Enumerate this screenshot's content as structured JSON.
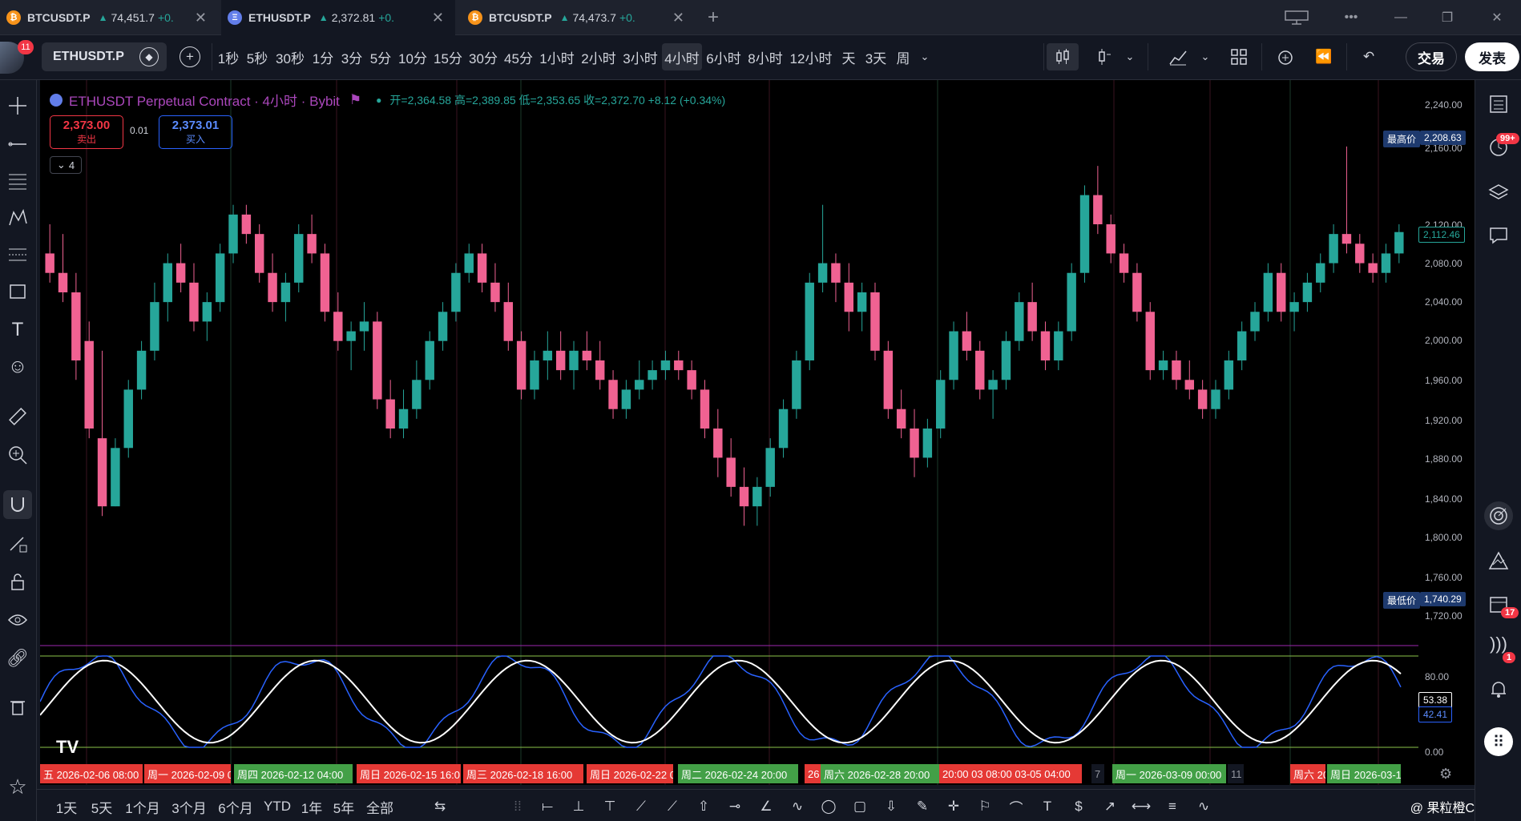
{
  "tabs": [
    {
      "coin": "₿",
      "coin_color": "#f7931a",
      "symbol": "BTCUSDT.P",
      "price": "74,451.7",
      "change": "+0.",
      "active": false
    },
    {
      "coin": "Ξ",
      "coin_color": "#627eea",
      "symbol": "ETHUSDT.P",
      "price": "2,372.81",
      "change": "+0.",
      "active": true
    },
    {
      "coin": "₿",
      "coin_color": "#f7931a",
      "symbol": "BTCUSDT.P",
      "price": "74,473.7",
      "change": "+0.",
      "active": false
    }
  ],
  "toolbar": {
    "avatar_badge": "11",
    "symbol": "ETHUSDT.P",
    "intervals": [
      "1秒",
      "5秒",
      "30秒",
      "1分",
      "3分",
      "5分",
      "10分",
      "15分",
      "30分",
      "45分",
      "1小时",
      "2小时",
      "3小时",
      "4小时",
      "6小时",
      "8小时",
      "12小时",
      "天",
      "3天",
      "周"
    ],
    "active_interval": "4小时",
    "trade_label": "交易",
    "publish_label": "发表"
  },
  "legend": {
    "title": "ETHUSDT Perpetual Contract · 4小时 · Bybit",
    "ohlc": "开=2,364.58 高=2,389.85 低=2,353.65 收=2,372.70 +8.12 (+0.34%)"
  },
  "quote": {
    "sell_price": "2,373.00",
    "sell_label": "卖出",
    "spread": "0.01",
    "buy_price": "2,373.01",
    "buy_label": "买入",
    "collapse_count": "4"
  },
  "price_axis": {
    "labels": [
      "2,240.00",
      "2,160.00",
      "2,120.00",
      "2,080.00",
      "2,040.00",
      "2,000.00",
      "1,960.00",
      "1,920.00",
      "1,880.00",
      "1,840.00",
      "1,800.00",
      "1,760.00",
      "1,720.00"
    ],
    "high_label": "最高价",
    "high_value": "2,208.63",
    "low_label": "最低价",
    "low_value": "1,740.29",
    "last_value": "2,112.46"
  },
  "oscillator": {
    "labels": [
      "80.00",
      "0.00"
    ],
    "k_value": "53.38",
    "d_value": "42.41"
  },
  "time_axis": [
    {
      "text": "五 2026-02-06  08:00",
      "bg": "#e53935"
    },
    {
      "text": "周一 2026-02-09  04:0",
      "bg": "#e53935"
    },
    {
      "text": "周四 2026-02-12  04:00",
      "bg": "#43a047"
    },
    {
      "text": "周日 2026-02-15  16:0",
      "bg": "#e53935"
    },
    {
      "text": "周三 2026-02-18  16:00",
      "bg": "#e53935"
    },
    {
      "text": "周日 2026-02-22  0",
      "bg": "#e53935"
    },
    {
      "text": "周二 2026-02-24  20:00",
      "bg": "#43a047"
    },
    {
      "text": "26",
      "bg": "#e53935"
    },
    {
      "text": "周六 2026-02-28  20:00",
      "bg": "#43a047"
    },
    {
      "text": "20:00  03  08:00  03-05  04:00",
      "bg": "#e53935"
    },
    {
      "text": "7",
      "bg": "#131722"
    },
    {
      "text": "周一 2026-03-09  00:00",
      "bg": "#43a047"
    },
    {
      "text": "11",
      "bg": "#131722"
    },
    {
      "text": "周六 20",
      "bg": "#e53935"
    },
    {
      "text": "周日 2026-03-15",
      "bg": "#43a047"
    }
  ],
  "bottom": {
    "ranges": [
      "1天",
      "5天",
      "1个月",
      "3个月",
      "6个月",
      "YTD",
      "1年",
      "5年",
      "全部"
    ],
    "watermark": "@ 果粒橙C"
  },
  "right_badges": {
    "alerts": "99+",
    "notifications": "17",
    "messages": "1"
  },
  "colors": {
    "up": "#26a69a",
    "down": "#f06292",
    "k_line": "#2962ff",
    "d_line": "#ffffff"
  },
  "chart_data": {
    "type": "candlestick",
    "ylim": [
      1700,
      2260
    ],
    "open_last": 2364.58,
    "high_last": 2389.85,
    "low_last": 2353.65,
    "close_last": 2372.7,
    "candles": [
      [
        2090,
        2120,
        2060,
        2070
      ],
      [
        2070,
        2110,
        2040,
        2050
      ],
      [
        2050,
        2070,
        1960,
        1980
      ],
      [
        2000,
        2020,
        1900,
        1910
      ],
      [
        1900,
        1990,
        1820,
        1830
      ],
      [
        1830,
        1900,
        1830,
        1890
      ],
      [
        1890,
        1960,
        1880,
        1950
      ],
      [
        1950,
        2000,
        1940,
        1990
      ],
      [
        1990,
        2060,
        1980,
        2040
      ],
      [
        2040,
        2090,
        2020,
        2080
      ],
      [
        2080,
        2100,
        2050,
        2060
      ],
      [
        2060,
        2080,
        2010,
        2020
      ],
      [
        2020,
        2050,
        2000,
        2040
      ],
      [
        2040,
        2100,
        2030,
        2090
      ],
      [
        2090,
        2140,
        2080,
        2130
      ],
      [
        2130,
        2140,
        2100,
        2110
      ],
      [
        2110,
        2120,
        2060,
        2070
      ],
      [
        2070,
        2090,
        2030,
        2040
      ],
      [
        2040,
        2070,
        2020,
        2060
      ],
      [
        2060,
        2120,
        2050,
        2110
      ],
      [
        2110,
        2130,
        2080,
        2090
      ],
      [
        2090,
        2100,
        2020,
        2030
      ],
      [
        2030,
        2050,
        1990,
        2000
      ],
      [
        2000,
        2020,
        1970,
        2010
      ],
      [
        2010,
        2040,
        1990,
        2020
      ],
      [
        2020,
        2030,
        1930,
        1940
      ],
      [
        1940,
        1960,
        1900,
        1910
      ],
      [
        1910,
        1950,
        1900,
        1930
      ],
      [
        1930,
        1980,
        1920,
        1960
      ],
      [
        1960,
        2010,
        1950,
        2000
      ],
      [
        2000,
        2040,
        1990,
        2030
      ],
      [
        2030,
        2080,
        2020,
        2070
      ],
      [
        2070,
        2100,
        2060,
        2090
      ],
      [
        2090,
        2100,
        2050,
        2060
      ],
      [
        2060,
        2080,
        2030,
        2040
      ],
      [
        2040,
        2060,
        1990,
        2000
      ],
      [
        2000,
        2010,
        1940,
        1950
      ],
      [
        1950,
        1990,
        1940,
        1980
      ],
      [
        1980,
        2010,
        1960,
        1990
      ],
      [
        1990,
        2010,
        1960,
        1970
      ],
      [
        1970,
        2000,
        1950,
        1990
      ],
      [
        1990,
        2010,
        1970,
        1980
      ],
      [
        1980,
        2000,
        1950,
        1960
      ],
      [
        1960,
        1970,
        1920,
        1930
      ],
      [
        1930,
        1960,
        1920,
        1950
      ],
      [
        1950,
        1980,
        1940,
        1960
      ],
      [
        1960,
        1980,
        1950,
        1970
      ],
      [
        1970,
        1990,
        1960,
        1980
      ],
      [
        1980,
        1990,
        1960,
        1970
      ],
      [
        1970,
        1980,
        1940,
        1950
      ],
      [
        1950,
        1960,
        1900,
        1910
      ],
      [
        1910,
        1930,
        1860,
        1880
      ],
      [
        1880,
        1900,
        1840,
        1850
      ],
      [
        1850,
        1870,
        1810,
        1830
      ],
      [
        1830,
        1860,
        1810,
        1850
      ],
      [
        1850,
        1900,
        1840,
        1890
      ],
      [
        1890,
        1940,
        1880,
        1930
      ],
      [
        1930,
        1990,
        1920,
        1980
      ],
      [
        1980,
        2070,
        1970,
        2060
      ],
      [
        2060,
        2140,
        2050,
        2080
      ],
      [
        2080,
        2090,
        2040,
        2060
      ],
      [
        2060,
        2080,
        2010,
        2030
      ],
      [
        2030,
        2060,
        2010,
        2050
      ],
      [
        2050,
        2060,
        1980,
        1990
      ],
      [
        1990,
        2000,
        1920,
        1930
      ],
      [
        1930,
        1950,
        1900,
        1910
      ],
      [
        1910,
        1930,
        1860,
        1880
      ],
      [
        1880,
        1920,
        1870,
        1910
      ],
      [
        1910,
        1970,
        1900,
        1960
      ],
      [
        1960,
        2020,
        1950,
        2010
      ],
      [
        2010,
        2030,
        1980,
        1990
      ],
      [
        1990,
        2000,
        1940,
        1950
      ],
      [
        1950,
        1970,
        1920,
        1960
      ],
      [
        1960,
        2010,
        1950,
        2000
      ],
      [
        2000,
        2050,
        1990,
        2040
      ],
      [
        2040,
        2060,
        2000,
        2010
      ],
      [
        2010,
        2020,
        1970,
        1980
      ],
      [
        1980,
        2020,
        1970,
        2010
      ],
      [
        2010,
        2080,
        2000,
        2070
      ],
      [
        2070,
        2160,
        2060,
        2150
      ],
      [
        2150,
        2180,
        2110,
        2120
      ],
      [
        2120,
        2130,
        2080,
        2090
      ],
      [
        2090,
        2100,
        2060,
        2070
      ],
      [
        2070,
        2080,
        2020,
        2030
      ],
      [
        2030,
        2040,
        1960,
        1970
      ],
      [
        1970,
        1990,
        1960,
        1980
      ],
      [
        1980,
        1990,
        1950,
        1960
      ],
      [
        1960,
        1980,
        1940,
        1950
      ],
      [
        1950,
        1960,
        1920,
        1930
      ],
      [
        1930,
        1960,
        1920,
        1950
      ],
      [
        1950,
        1990,
        1940,
        1980
      ],
      [
        1980,
        2020,
        1970,
        2010
      ],
      [
        2010,
        2040,
        2000,
        2030
      ],
      [
        2030,
        2080,
        2020,
        2070
      ],
      [
        2070,
        2080,
        2020,
        2030
      ],
      [
        2030,
        2050,
        2010,
        2040
      ],
      [
        2040,
        2070,
        2030,
        2060
      ],
      [
        2060,
        2090,
        2050,
        2080
      ],
      [
        2080,
        2120,
        2070,
        2110
      ],
      [
        2110,
        2200,
        2090,
        2100
      ],
      [
        2100,
        2110,
        2070,
        2080
      ],
      [
        2080,
        2090,
        2060,
        2070
      ],
      [
        2070,
        2100,
        2060,
        2090
      ],
      [
        2090,
        2120,
        2080,
        2112
      ]
    ]
  }
}
